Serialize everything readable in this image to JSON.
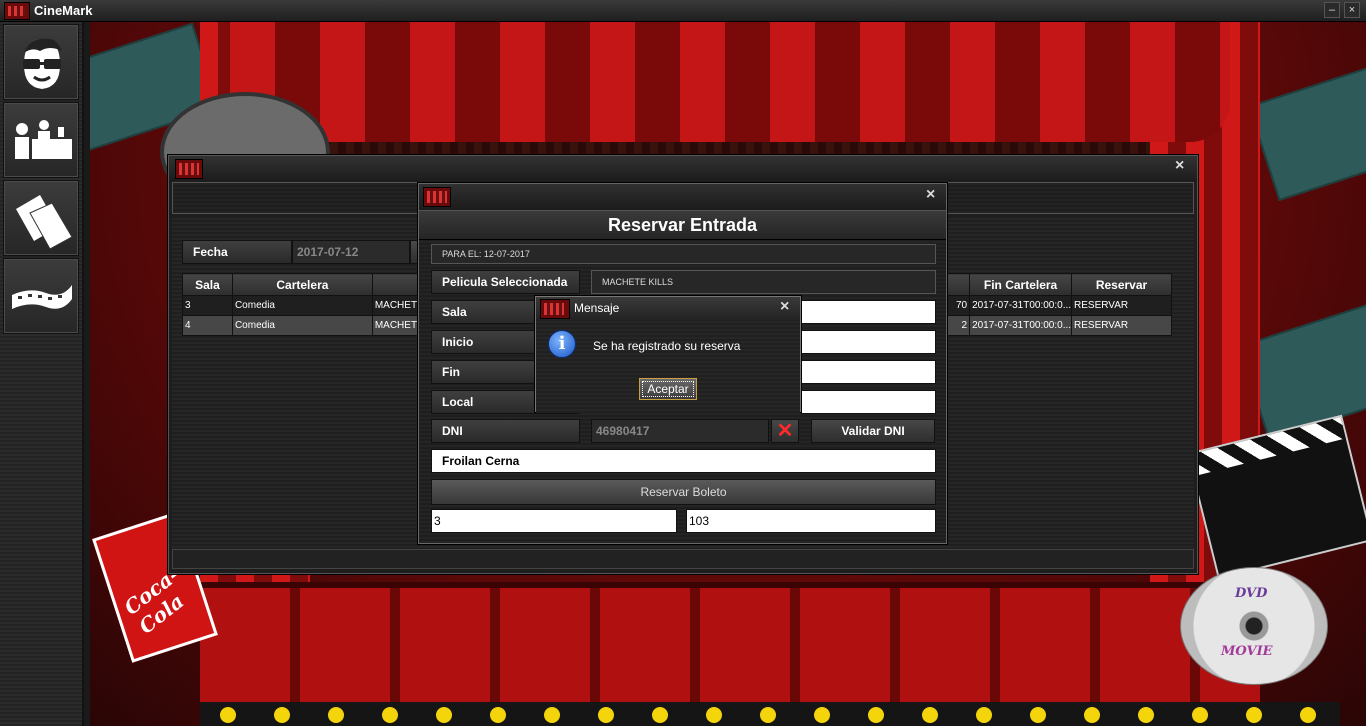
{
  "app": {
    "title": "CineMark"
  },
  "window_buttons": {
    "minimize": "–",
    "close": "×"
  },
  "sidebar": {
    "items": [
      {
        "name": "sidebar-item-cliente",
        "icon": "user-glasses-icon"
      },
      {
        "name": "sidebar-item-taquilla",
        "icon": "cashier-icon"
      },
      {
        "name": "sidebar-item-tickets",
        "icon": "tickets-icon"
      },
      {
        "name": "sidebar-item-film",
        "icon": "film-strip-icon"
      }
    ]
  },
  "background": {
    "cola_text": "Coca-Cola",
    "dvd_top": "DVD",
    "dvd_bottom": "MOVIE"
  },
  "main_frame": {
    "close": "×",
    "fecha_label": "Fecha",
    "fecha_value": "2017-07-12",
    "table": {
      "headers": {
        "sala": "Sala",
        "cartelera": "Cartelera",
        "fin": "Fin Cartelera",
        "reservar": "Reservar"
      },
      "rows": [
        {
          "sala": "3",
          "cartelera": "Comedia",
          "titulo": "MACHETE",
          "inicio_tail": "70",
          "fin": "2017-07-31T00:00:0...",
          "reservar": "RESERVAR"
        },
        {
          "sala": "4",
          "cartelera": "Comedia",
          "titulo": "MACHETE",
          "inicio_tail": "2",
          "fin": "2017-07-31T00:00:0...",
          "reservar": "RESERVAR"
        }
      ]
    }
  },
  "reservar_dialog": {
    "close": "×",
    "title": "Reservar Entrada",
    "para_el": "PARA EL: 12-07-2017",
    "pelicula_label": "Pelicula Seleccionada",
    "pelicula_value": "MACHETE KILLS",
    "sala_label": "Sala",
    "inicio_label": "Inicio",
    "fin_label": "Fin",
    "local_label": "Local",
    "dni_label": "DNI",
    "dni_value": "46980417",
    "dni_clear": "✕",
    "validar_label": "Validar DNI",
    "nombre_value": "Froilan Cerna",
    "reservar_label": "Reservar Boleto",
    "bottom_left_value": "3",
    "bottom_right_value": "103"
  },
  "message_dialog": {
    "title": "Mensaje",
    "close": "×",
    "icon": "info-icon",
    "icon_glyph": "i",
    "text": "Se ha registrado su reserva",
    "ok_label": "Aceptar"
  }
}
